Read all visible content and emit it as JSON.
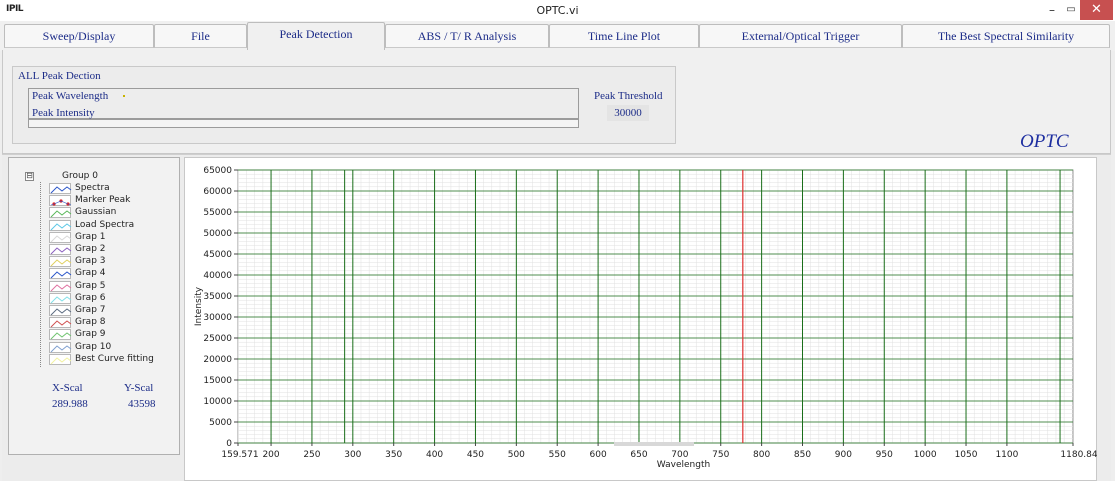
{
  "window": {
    "app_icon_text": "IPIL",
    "title": "OPTC.vi",
    "min_glyph": "–",
    "max_glyph": "▭",
    "close_glyph": "✕"
  },
  "tabs": [
    {
      "label": "Sweep/Display",
      "active": false
    },
    {
      "label": "File",
      "active": false
    },
    {
      "label": "Peak Detection",
      "active": true
    },
    {
      "label": "ABS / T/ R Analysis",
      "active": false
    },
    {
      "label": "Time Line Plot",
      "active": false
    },
    {
      "label": "External/Optical Trigger",
      "active": false
    },
    {
      "label": "The Best Spectral Similarity",
      "active": false
    }
  ],
  "peak_detection": {
    "group_title": "ALL Peak Dection",
    "wavelength_label": "Peak Wavelength",
    "intensity_label": "Peak Intensity",
    "threshold_label": "Peak Threshold",
    "threshold_value": "30000"
  },
  "logo": "OPTC",
  "legend": {
    "group_expander": "⊟",
    "group_label": "Group 0",
    "items": [
      {
        "label": "Spectra",
        "color": "#2b56c9",
        "style": "line"
      },
      {
        "label": "Marker Peak",
        "color": "#e02020",
        "style": "marker"
      },
      {
        "label": "Gaussian",
        "color": "#5ab85a",
        "style": "line"
      },
      {
        "label": "Load Spectra",
        "color": "#5bc8e6",
        "style": "line"
      },
      {
        "label": "Grap 1",
        "color": "#d8d8d8",
        "style": "line"
      },
      {
        "label": "Grap 2",
        "color": "#8b5fbf",
        "style": "line"
      },
      {
        "label": "Grap 3",
        "color": "#e0d060",
        "style": "line"
      },
      {
        "label": "Grap 4",
        "color": "#2b56c9",
        "style": "line"
      },
      {
        "label": "Grap 5",
        "color": "#e070a0",
        "style": "line"
      },
      {
        "label": "Grap 6",
        "color": "#80e0e8",
        "style": "line"
      },
      {
        "label": "Grap 7",
        "color": "#5a6a80",
        "style": "line"
      },
      {
        "label": "Grap 8",
        "color": "#d05050",
        "style": "line"
      },
      {
        "label": "Grap 9",
        "color": "#6fc46f",
        "style": "line"
      },
      {
        "label": "Grap 10",
        "color": "#7fa0d0",
        "style": "line"
      },
      {
        "label": "Best Curve fitting",
        "color": "#f2f2a0",
        "style": "line"
      }
    ]
  },
  "scale": {
    "x_label": "X-Scal",
    "y_label": "Y-Scal",
    "x_value": "289.988",
    "y_value": "43598"
  },
  "chart_data": {
    "type": "line",
    "title": "",
    "xlabel": "Wavelength",
    "ylabel": "Intensity",
    "xlim": [
      159.571,
      1180.84
    ],
    "ylim": [
      0,
      65000
    ],
    "x_tick_labels": [
      "159.571",
      "200",
      "250",
      "300",
      "350",
      "400",
      "450",
      "500",
      "550",
      "600",
      "650",
      "700",
      "750",
      "800",
      "850",
      "900",
      "950",
      "1000",
      "1050",
      "1100",
      "1180.84"
    ],
    "y_tick_labels": [
      "0",
      "5000",
      "10000",
      "15000",
      "20000",
      "25000",
      "30000",
      "35000",
      "40000",
      "45000",
      "50000",
      "55000",
      "60000",
      "65000"
    ],
    "grid": true,
    "colors": {
      "grid_major": "#1a6e1a",
      "grid_minor": "#e0e0e0",
      "peak_line": "#e03030"
    },
    "vertical_lines_x": [
      200,
      250,
      290,
      300,
      350,
      400,
      450,
      500,
      550,
      600,
      650,
      700,
      750,
      800,
      850,
      900,
      950,
      1000,
      1050,
      1100,
      1165
    ],
    "peak_marker_x": 777,
    "series": []
  }
}
